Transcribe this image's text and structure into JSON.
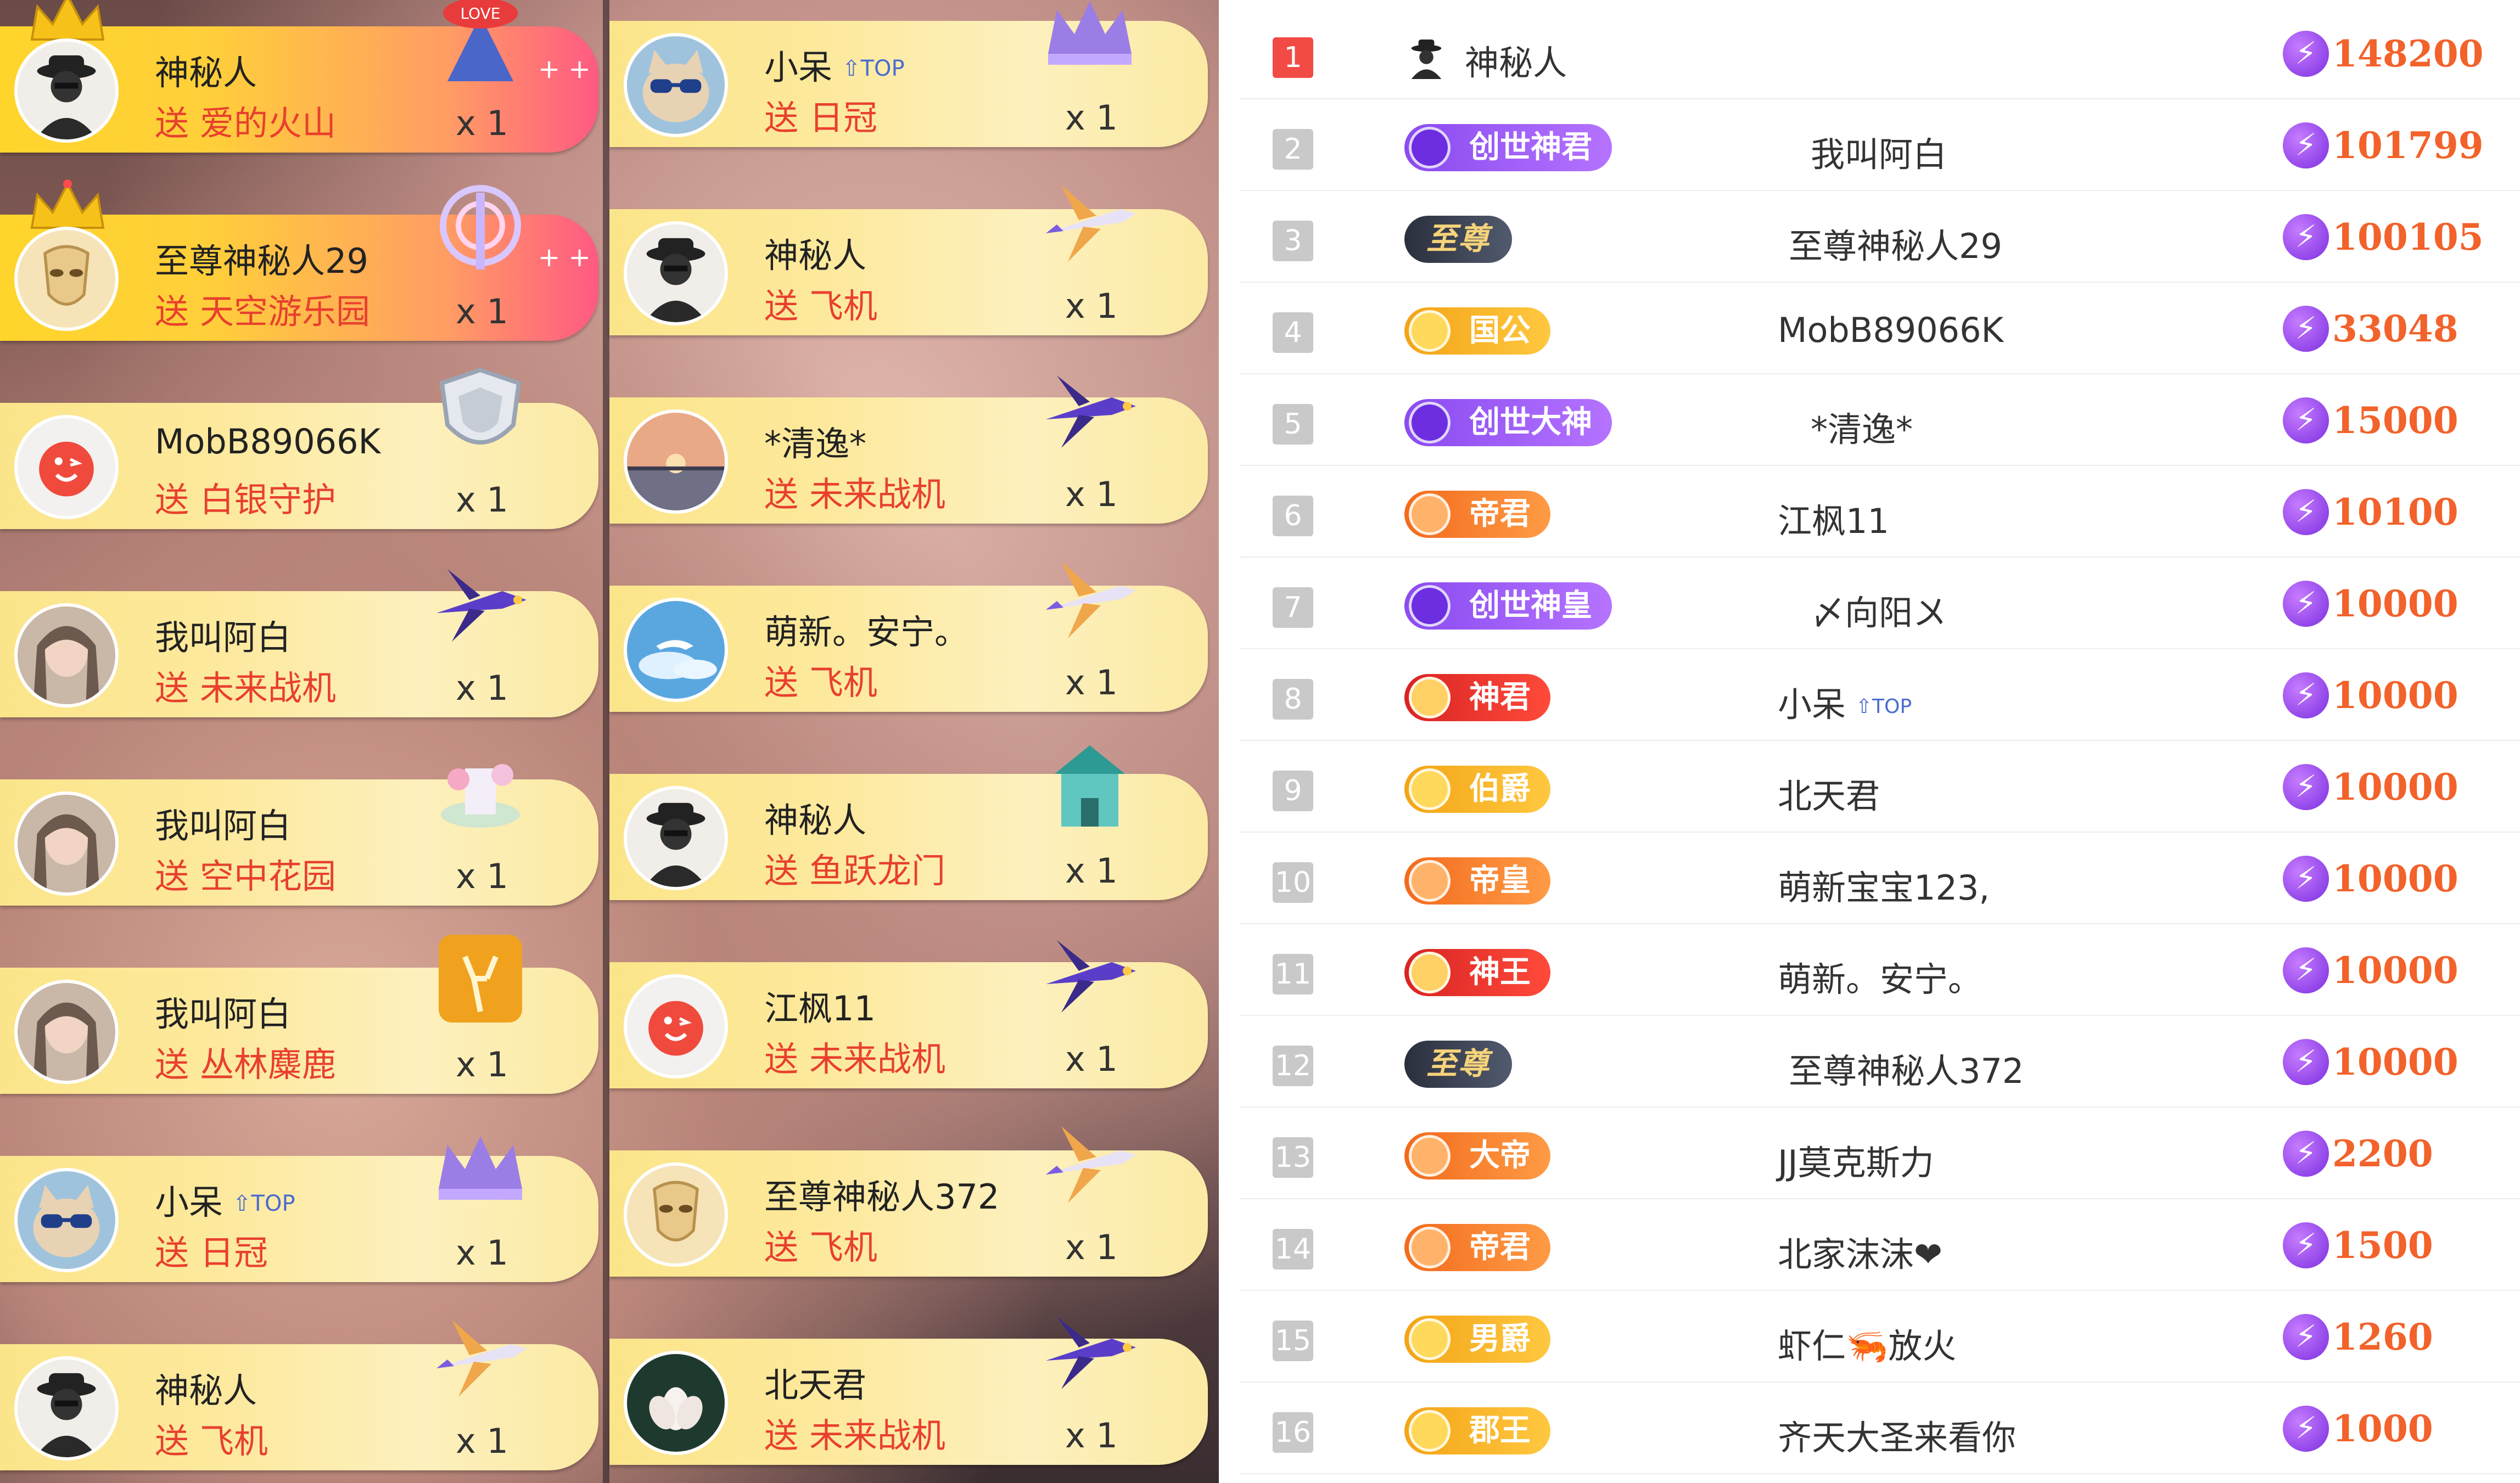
{
  "gift_feed": {
    "left": [
      {
        "sender": "神秘人",
        "action": "送",
        "gift": "爱的火山",
        "count": "x 1",
        "avatar": "mystery-man",
        "highlight": true,
        "crown": true,
        "gift_icon": "love-volcano-icon"
      },
      {
        "sender": "至尊神秘人29",
        "action": "送",
        "gift": "天空游乐园",
        "count": "x 1",
        "avatar": "gold-mask",
        "highlight": true,
        "crown": true,
        "gift_icon": "sky-park-icon"
      },
      {
        "sender": "MobB89066K",
        "action": "送",
        "gift": "白银守护",
        "count": "x 1",
        "avatar": "red-smile",
        "highlight": false,
        "gift_icon": "silver-shield-icon"
      },
      {
        "sender": "我叫阿白",
        "action": "送",
        "gift": "未来战机",
        "count": "x 1",
        "avatar": "girl-photo",
        "highlight": false,
        "gift_icon": "future-jet-icon"
      },
      {
        "sender": "我叫阿白",
        "action": "送",
        "gift": "空中花园",
        "count": "x 1",
        "avatar": "girl-photo",
        "highlight": false,
        "gift_icon": "sky-garden-icon"
      },
      {
        "sender": "我叫阿白",
        "action": "送",
        "gift": "丛林麋鹿",
        "count": "x 1",
        "avatar": "girl-photo",
        "highlight": false,
        "gift_icon": "jungle-elk-icon"
      },
      {
        "sender": "小呆",
        "action": "送",
        "gift": "日冠",
        "count": "x 1",
        "avatar": "cat-sunglasses",
        "highlight": false,
        "top_badge": "TOP",
        "gift_icon": "sun-crown-icon"
      },
      {
        "sender": "神秘人",
        "action": "送",
        "gift": "飞机",
        "count": "x 1",
        "avatar": "mystery-man",
        "highlight": false,
        "gift_icon": "airplane-icon"
      }
    ],
    "right": [
      {
        "sender": "小呆",
        "action": "送",
        "gift": "日冠",
        "count": "x 1",
        "avatar": "cat-sunglasses",
        "highlight": false,
        "top_badge": "TOP",
        "gift_icon": "sun-crown-icon"
      },
      {
        "sender": "神秘人",
        "action": "送",
        "gift": "飞机",
        "count": "x 1",
        "avatar": "mystery-man",
        "highlight": false,
        "gift_icon": "airplane-icon"
      },
      {
        "sender": "*清逸*",
        "action": "送",
        "gift": "未来战机",
        "count": "x 1",
        "avatar": "sunset-photo",
        "highlight": false,
        "gift_icon": "future-jet-icon"
      },
      {
        "sender": "萌新。安宁。",
        "action": "送",
        "gift": "飞机",
        "count": "x 1",
        "avatar": "whale-sky",
        "highlight": false,
        "gift_icon": "airplane-icon"
      },
      {
        "sender": "神秘人",
        "action": "送",
        "gift": "鱼跃龙门",
        "count": "x 1",
        "avatar": "mystery-man",
        "highlight": false,
        "gift_icon": "dragon-gate-icon"
      },
      {
        "sender": "江枫11",
        "action": "送",
        "gift": "未来战机",
        "count": "x 1",
        "avatar": "red-smile",
        "highlight": false,
        "gift_icon": "future-jet-icon"
      },
      {
        "sender": "至尊神秘人372",
        "action": "送",
        "gift": "飞机",
        "count": "x 1",
        "avatar": "gold-mask",
        "highlight": false,
        "gift_icon": "airplane-icon"
      },
      {
        "sender": "北天君",
        "action": "送",
        "gift": "未来战机",
        "count": "x 1",
        "avatar": "lotus-photo",
        "highlight": false,
        "gift_icon": "future-jet-icon"
      }
    ]
  },
  "leaderboard": [
    {
      "rank": "1",
      "badge": "",
      "badge_style": "none",
      "name": "神秘人",
      "score": "148200"
    },
    {
      "rank": "2",
      "badge": "创世神君",
      "badge_style": "purple",
      "name": "我叫阿白",
      "score": "101799"
    },
    {
      "rank": "3",
      "badge": "至尊",
      "badge_style": "black",
      "name": "至尊神秘人29",
      "score": "100105"
    },
    {
      "rank": "4",
      "badge": "国公",
      "badge_style": "gold",
      "name": "MobB89066K",
      "score": "33048"
    },
    {
      "rank": "5",
      "badge": "创世大神",
      "badge_style": "purple",
      "name": "*清逸*",
      "score": "15000"
    },
    {
      "rank": "6",
      "badge": "帝君",
      "badge_style": "orange",
      "name": "江枫11",
      "score": "10100"
    },
    {
      "rank": "7",
      "badge": "创世神皇",
      "badge_style": "purple",
      "name": "〆向阳〤",
      "score": "10000"
    },
    {
      "rank": "8",
      "badge": "神君",
      "badge_style": "red",
      "name": "小呆",
      "score": "10000",
      "top_badge": "TOP"
    },
    {
      "rank": "9",
      "badge": "伯爵",
      "badge_style": "gold",
      "name": "北天君",
      "score": "10000"
    },
    {
      "rank": "10",
      "badge": "帝皇",
      "badge_style": "orange",
      "name": "萌新宝宝123,",
      "score": "10000"
    },
    {
      "rank": "11",
      "badge": "神王",
      "badge_style": "red",
      "name": "萌新。安宁。",
      "score": "10000"
    },
    {
      "rank": "12",
      "badge": "至尊",
      "badge_style": "black",
      "name": "至尊神秘人372",
      "score": "10000"
    },
    {
      "rank": "13",
      "badge": "大帝",
      "badge_style": "orange",
      "name": "JJ莫克斯力",
      "score": "2200"
    },
    {
      "rank": "14",
      "badge": "帝君",
      "badge_style": "orange",
      "name": "北家沫沫❤",
      "score": "1500"
    },
    {
      "rank": "15",
      "badge": "男爵",
      "badge_style": "gold",
      "name": "虾仁🦐放火",
      "score": "1260"
    },
    {
      "rank": "16",
      "badge": "郡王",
      "badge_style": "gold",
      "name": "齐天大圣来看你",
      "score": "1000"
    }
  ],
  "colors": {
    "rank_first": "#f24b46",
    "rank_other": "#c9c9c9",
    "score": "#f2622b",
    "gift_text": "#e8402e"
  }
}
